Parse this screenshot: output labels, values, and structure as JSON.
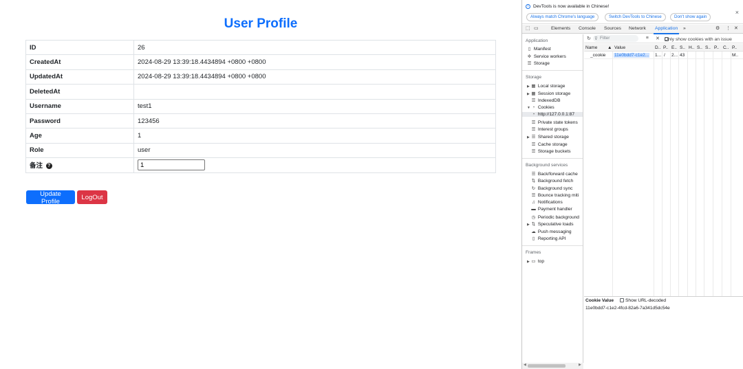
{
  "page": {
    "title": "User Profile",
    "rows": [
      {
        "key": "ID",
        "value": "26"
      },
      {
        "key": "CreatedAt",
        "value": "2024-08-29 13:39:18.4434894 +0800 +0800"
      },
      {
        "key": "UpdatedAt",
        "value": "2024-08-29 13:39:18.4434894 +0800 +0800"
      },
      {
        "key": "DeletedAt",
        "value": ""
      },
      {
        "key": "Username",
        "value": "test1"
      },
      {
        "key": "Password",
        "value": "123456"
      },
      {
        "key": "Age",
        "value": "1"
      },
      {
        "key": "Role",
        "value": "user"
      }
    ],
    "remark": {
      "key": "备注",
      "info_icon": "?",
      "input_value": "1"
    },
    "buttons": {
      "update": "Update Profile",
      "logout": "LogOut"
    },
    "colors": {
      "primary": "#0d6efd",
      "danger": "#dc3545"
    }
  },
  "devtools": {
    "banner": {
      "message": "DevTools is now available in Chinese!",
      "btn_match": "Always match Chrome's language",
      "btn_switch": "Switch DevTools to Chinese",
      "btn_dont_show": "Don't show again",
      "close": "×"
    },
    "tabs": [
      "Elements",
      "Console",
      "Sources",
      "Network",
      "Application"
    ],
    "more_tabs": "»",
    "sidebar": {
      "application_head": "Application",
      "application_items": [
        "Manifest",
        "Service workers",
        "Storage"
      ],
      "storage_head": "Storage",
      "storage_items": [
        "Local storage",
        "Session storage",
        "IndexedDB",
        "Cookies",
        "http://127.0.0.1:87",
        "Private state tokens",
        "Interest groups",
        "Shared storage",
        "Cache storage",
        "Storage buckets"
      ],
      "background_head": "Background services",
      "background_items": [
        "Back/forward cache",
        "Background fetch",
        "Background sync",
        "Bounce tracking miti",
        "Notifications",
        "Payment handler",
        "Periodic background",
        "Speculative loads",
        "Push messaging",
        "Reporting API"
      ],
      "frames_head": "Frames",
      "frames_items": [
        "top"
      ]
    },
    "toolbar": {
      "filter_placeholder": "Filter",
      "only_issue": "Only show cookies with an issue"
    },
    "grid": {
      "headers": [
        "Name",
        "▲",
        "Value",
        "D..",
        "P..",
        "E..",
        "S..",
        "H..",
        "S..",
        "S..",
        "P..",
        "C..",
        "P.."
      ],
      "row": {
        "name": "_cookie",
        "value": "11e0bdd7-c1e2...",
        "domain": "1...",
        "path": "/",
        "expires": "2...",
        "size": "43",
        "last": "M.."
      }
    },
    "cookie_value": {
      "title": "Cookie Value",
      "decode_label": "Show URL-decoded",
      "value": "11e0bdd7-c1e2-4fcd-82a6-7a341d5dc54e"
    }
  }
}
